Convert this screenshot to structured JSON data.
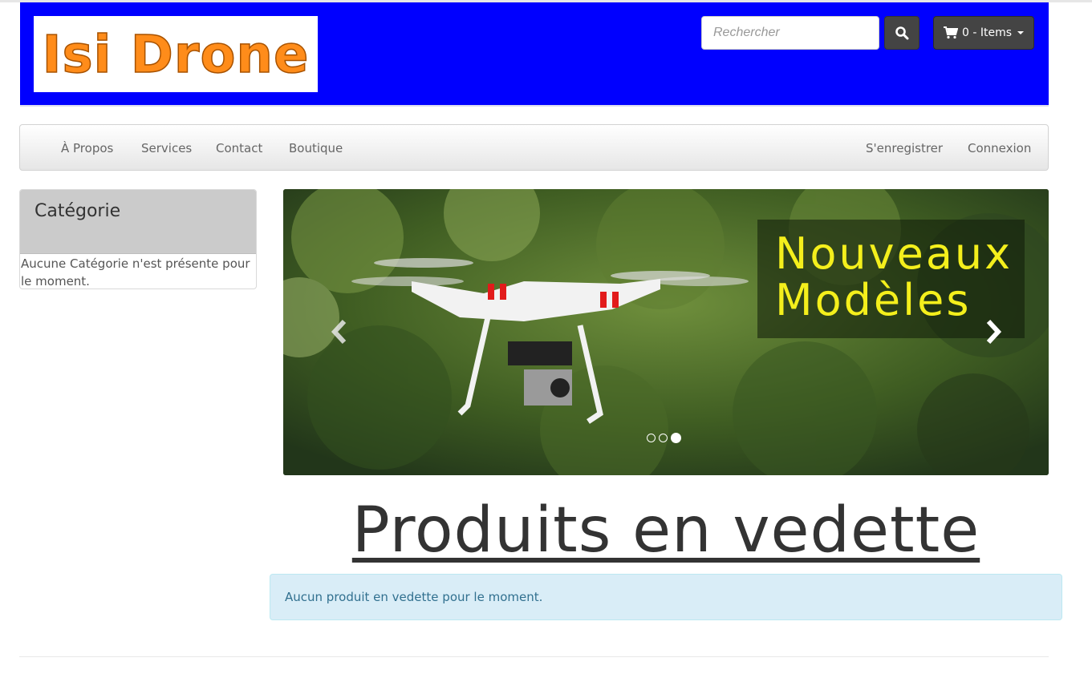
{
  "header": {
    "logo_text": "Isi Drone",
    "logo_color": "#ff8c1a",
    "background_color": "#0000ff",
    "search": {
      "placeholder": "Rechercher",
      "value": "",
      "icon": "search-icon"
    },
    "cart": {
      "label": "0 - Items",
      "icon": "shopping-cart-icon",
      "dropdown_icon": "caret-down-icon"
    }
  },
  "nav": {
    "left_items": [
      {
        "label": "À Propos"
      },
      {
        "label": "Services"
      },
      {
        "label": "Contact"
      },
      {
        "label": "Boutique"
      }
    ],
    "right_items": [
      {
        "label": "S'enregistrer"
      },
      {
        "label": "Connexion"
      }
    ]
  },
  "sidebar": {
    "heading": "Catégorie",
    "body": "Aucune Catégorie n'est présente pour le moment."
  },
  "carousel": {
    "caption_line1": "Nouveaux",
    "caption_line2": "Modèles",
    "caption_color": "#f4ef1c",
    "prev_icon": "chevron-left-icon",
    "next_icon": "chevron-right-icon",
    "slide_count": 3,
    "active_slide": 3
  },
  "featured": {
    "title": "Produits en vedette",
    "empty_message": "Aucun produit en vedette pour le moment."
  }
}
